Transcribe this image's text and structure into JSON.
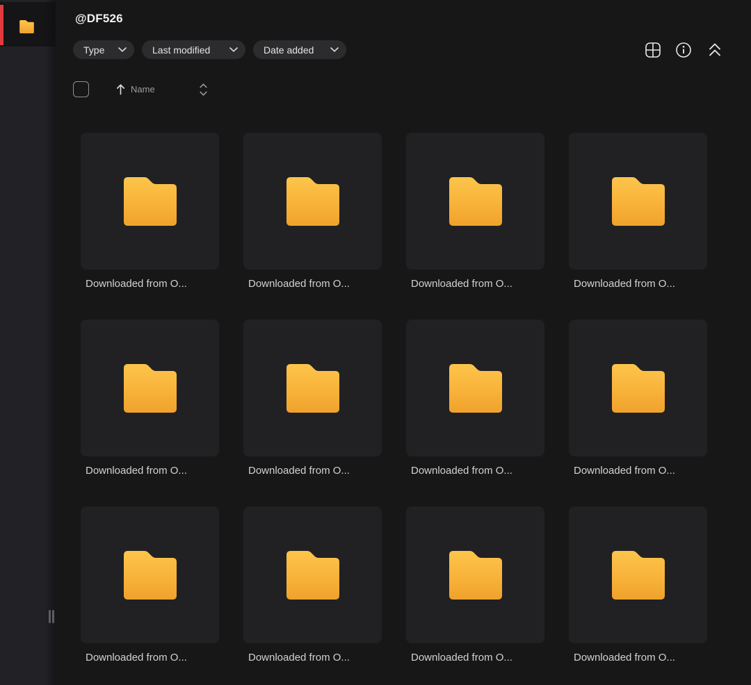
{
  "sidebar": {
    "selected_item": {
      "icon": "folder-icon",
      "accent_color": "#e23a3e"
    }
  },
  "header": {
    "title": "@DF526",
    "filters": [
      {
        "label": "Type"
      },
      {
        "label": "Last modified"
      },
      {
        "label": "Date added"
      }
    ],
    "view_controls": [
      {
        "icon": "grid-view-icon"
      },
      {
        "icon": "info-icon"
      },
      {
        "icon": "collapse-all-icon"
      }
    ]
  },
  "sort_bar": {
    "checkbox_checked": false,
    "sort_field": "Name",
    "sort_direction": "ascending",
    "icons": [
      "arrow-up-icon",
      "sort-updown-icon"
    ]
  },
  "grid": {
    "items": [
      {
        "icon": "folder-icon",
        "label": "Downloaded from O..."
      },
      {
        "icon": "folder-icon",
        "label": "Downloaded from O..."
      },
      {
        "icon": "folder-icon",
        "label": "Downloaded from O..."
      },
      {
        "icon": "folder-icon",
        "label": "Downloaded from O..."
      },
      {
        "icon": "folder-icon",
        "label": "Downloaded from O..."
      },
      {
        "icon": "folder-icon",
        "label": "Downloaded from O..."
      },
      {
        "icon": "folder-icon",
        "label": "Downloaded from O..."
      },
      {
        "icon": "folder-icon",
        "label": "Downloaded from O..."
      },
      {
        "icon": "folder-icon",
        "label": "Downloaded from O..."
      },
      {
        "icon": "folder-icon",
        "label": "Downloaded from O..."
      },
      {
        "icon": "folder-icon",
        "label": "Downloaded from O..."
      },
      {
        "icon": "folder-icon",
        "label": "Downloaded from O..."
      }
    ]
  },
  "colors": {
    "main_background": "#171718",
    "sidebar_background": "#222226",
    "tile_background": "#212124",
    "chip_background": "#2c2c2e",
    "accent_red": "#e23a3e",
    "folder_yellow_top": "#fdc54b",
    "folder_yellow_bottom": "#efa22c"
  }
}
